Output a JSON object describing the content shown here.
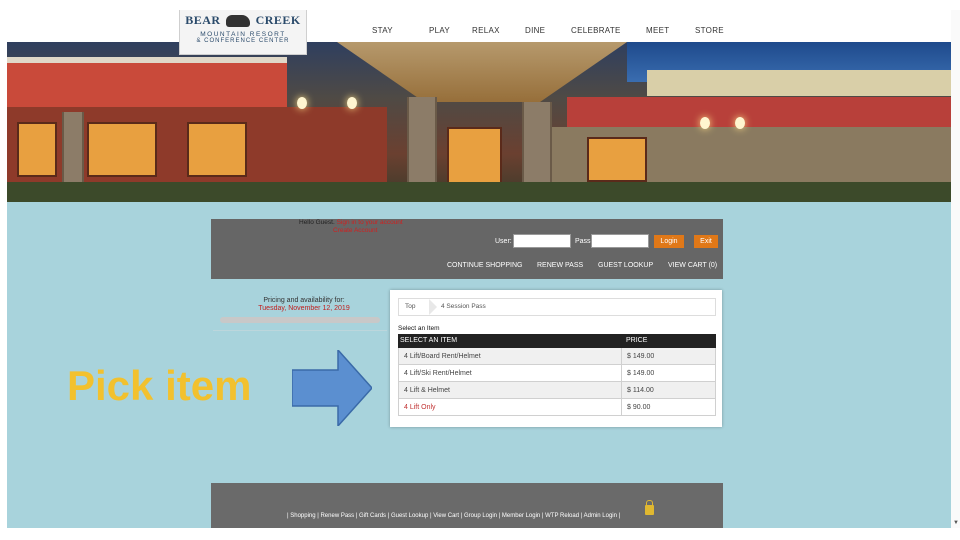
{
  "logo": {
    "brand_left": "BEAR",
    "brand_right": "CREEK",
    "line1": "MOUNTAIN RESORT",
    "line2": "& CONFERENCE CENTER"
  },
  "nav": [
    "STAY",
    "PLAY",
    "RELAX",
    "DINE",
    "CELEBRATE",
    "MEET",
    "STORE"
  ],
  "header": {
    "welcome_prefix": "Hello Guest.",
    "welcome_red_1": "Sign in to your account",
    "welcome_red_2": "Create Account",
    "user_label": "User:",
    "pass_label": "Pass:",
    "login_button": "Login",
    "exit_button": "Exit"
  },
  "panel_links": [
    "CONTINUE SHOPPING",
    "RENEW PASS",
    "GUEST LOOKUP",
    "VIEW CART (0)"
  ],
  "pricing": {
    "line1": "Pricing and availability for:",
    "date": "Tuesday, November 12, 2019"
  },
  "card": {
    "crumb_top": "Top",
    "crumb_current": "4 Session Pass",
    "select_label": "Select an Item",
    "col_item": "SELECT AN ITEM",
    "col_price": "PRICE",
    "rows": [
      {
        "name": "4 Lift/Board Rent/Helmet",
        "price": "$ 149.00"
      },
      {
        "name": "4 Lift/Ski Rent/Helmet",
        "price": "$ 149.00"
      },
      {
        "name": "4 Lift & Helmet",
        "price": "$ 114.00"
      },
      {
        "name": "4 Lift Only",
        "price": "$ 90.00"
      }
    ]
  },
  "annotation": {
    "text": "Pick item",
    "text_color": "#f2c12e",
    "arrow_color": "#5b8fd0"
  },
  "footer": {
    "links": "| Shopping | Renew Pass | Gift Cards | Guest Lookup | View Cart | Group Login | Member Login | WTP Reload | Admin Login |"
  },
  "colors": {
    "background": "#a8d3dc",
    "panel": "#666666",
    "button": "#e07818",
    "table_header": "#222222",
    "highlight_text": "#c03030"
  }
}
